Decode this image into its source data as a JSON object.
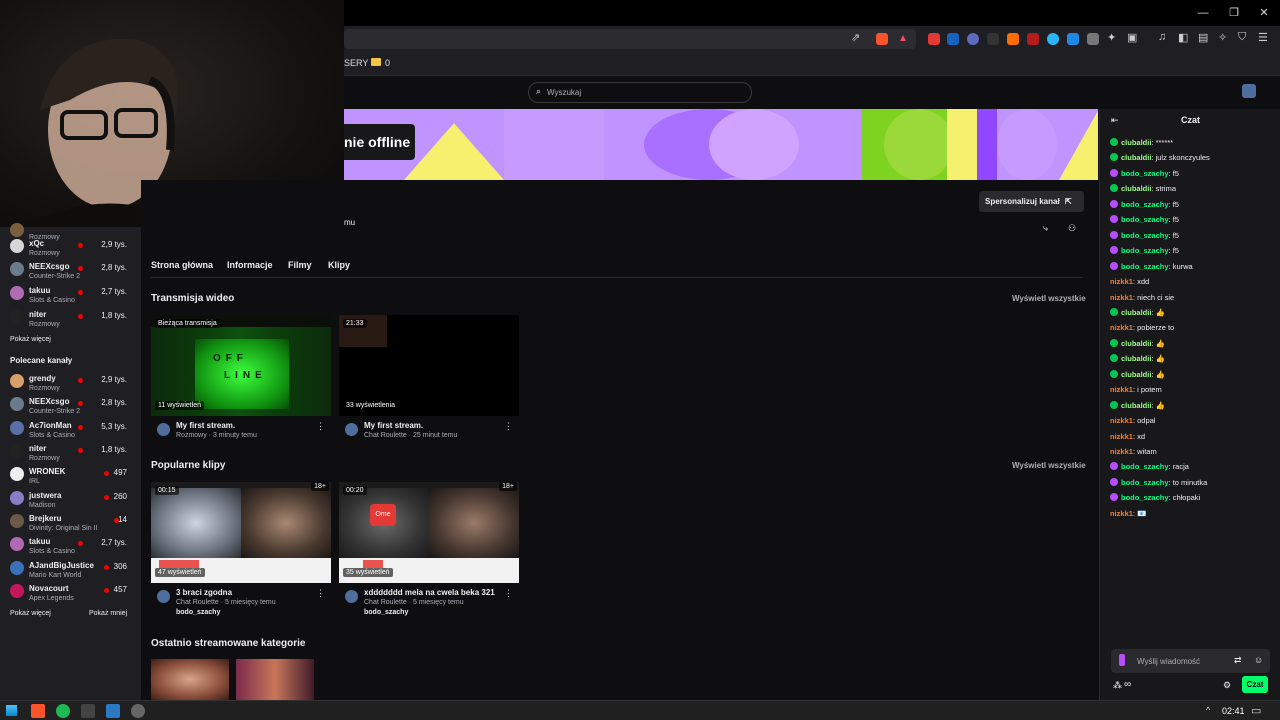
{
  "browser": {
    "bookmark_folder_label": "0",
    "bookmark_partial": "SERY",
    "window_buttons": [
      "—",
      "❐",
      "✕"
    ]
  },
  "nav": {
    "search_placeholder": "Wyszukaj"
  },
  "banner": {
    "offline_text": "nie offline",
    "customize_button": "Spersonalizuj kanał"
  },
  "channel": {
    "partial_text": "mu",
    "tabs": [
      "Strona główna",
      "Informacje",
      "Filmy",
      "Klipy"
    ]
  },
  "sidebar": {
    "followed": [
      {
        "name": "",
        "category": "Rozmowy",
        "viewers": ""
      },
      {
        "name": "xQc",
        "category": "Rozmowy",
        "viewers": "2,9 tys."
      },
      {
        "name": "NEEXcsgo",
        "category": "Counter-Strike 2",
        "viewers": "2,8 tys."
      },
      {
        "name": "takuu",
        "category": "Slots & Casino",
        "viewers": "2,7 tys."
      },
      {
        "name": "niter",
        "category": "Rozmowy",
        "viewers": "1,8 tys."
      }
    ],
    "show_more": "Pokaż więcej",
    "recommended_title": "Polecane kanały",
    "recommended": [
      {
        "name": "grendy",
        "category": "Rozmowy",
        "viewers": "2,9 tys."
      },
      {
        "name": "NEEXcsgo",
        "category": "Counter-Strike 2",
        "viewers": "2,8 tys."
      },
      {
        "name": "Ac7ionMan",
        "category": "Slots & Casino",
        "viewers": "5,3 tys."
      },
      {
        "name": "niter",
        "category": "Rozmowy",
        "viewers": "1,8 tys."
      },
      {
        "name": "WRONEK",
        "category": "IRL",
        "viewers": "497"
      },
      {
        "name": "justwera",
        "category": "Madison",
        "viewers": "260"
      },
      {
        "name": "Brejkeru",
        "category": "Divinity: Original Sin II",
        "viewers": "14"
      },
      {
        "name": "takuu",
        "category": "Slots & Casino",
        "viewers": "2,7 tys."
      },
      {
        "name": "AJandBigJustice",
        "category": "Mario Kart World",
        "viewers": "306"
      },
      {
        "name": "Novacourt",
        "category": "Apex Legends",
        "viewers": "457"
      }
    ],
    "show_more2": "Pokaż więcej",
    "show_less": "Pokaż mniej"
  },
  "videos": {
    "title": "Transmisja wideo",
    "see_all": "Wyświetl wszystkie",
    "items": [
      {
        "badge": "Bieżąca transmisja",
        "views": "11 wyświetleń",
        "title": "My first stream.",
        "sub": "Rozmowy · 3 minuty temu",
        "screen": [
          "OFF",
          "LINE"
        ]
      },
      {
        "badge": "21:33",
        "views": "33 wyświetlenia",
        "title": "My first stream.",
        "sub": "Chat Roulette · 25 minut temu"
      }
    ]
  },
  "clips": {
    "title": "Popularne klipy",
    "see_all": "Wyświetl wszystkie",
    "items": [
      {
        "badge": "00:15",
        "age": "18+",
        "views": "47 wyświetleń",
        "title": "3 braci zgodna",
        "sub": "Chat Roulette · 5 miesięcy temu",
        "author": "bodo_szachy"
      },
      {
        "badge": "00:20",
        "age": "18+",
        "views": "35 wyświetleń",
        "title": "xddddddd mela na cwela beka 321",
        "sub": "Chat Roulette · 5 miesięcy temu",
        "author": "bodo_szachy",
        "logo": "Ome"
      }
    ]
  },
  "categories": {
    "title": "Ostatnio streamowane kategorie"
  },
  "chat": {
    "title": "Czat",
    "messages": [
      {
        "user": "clubaldii",
        "text": "******",
        "mark": "#00c853",
        "color": "#9dff8a"
      },
      {
        "user": "clubaldii",
        "text": "julz skonczyules",
        "mark": "#00c853",
        "color": "#9dff8a"
      },
      {
        "user": "bodo_szachy",
        "text": "f5",
        "mark": "#b84dff",
        "color": "#00ff7f"
      },
      {
        "user": "clubaldii",
        "text": "strima",
        "mark": "#00c853",
        "color": "#9dff8a"
      },
      {
        "user": "bodo_szachy",
        "text": "f5",
        "mark": "#b84dff",
        "color": "#00ff7f"
      },
      {
        "user": "bodo_szachy",
        "text": "f5",
        "mark": "#b84dff",
        "color": "#00ff7f"
      },
      {
        "user": "bodo_szachy",
        "text": "f5",
        "mark": "#b84dff",
        "color": "#00ff7f"
      },
      {
        "user": "bodo_szachy",
        "text": "f5",
        "mark": "#b84dff",
        "color": "#00ff7f"
      },
      {
        "user": "bodo_szachy",
        "text": "kurwa",
        "mark": "#b84dff",
        "color": "#00ff7f"
      },
      {
        "user": "nizkk1",
        "text": "xdd",
        "mark": "",
        "color": "#ff7f24"
      },
      {
        "user": "nizkk1",
        "text": "niech ci sie",
        "mark": "",
        "color": "#ff7f24"
      },
      {
        "user": "clubaldii",
        "text": "👍",
        "mark": "#00c853",
        "color": "#9dff8a"
      },
      {
        "user": "nizkk1",
        "text": "pobierze to",
        "mark": "",
        "color": "#ff7f24"
      },
      {
        "user": "clubaldii",
        "text": "👍",
        "mark": "#00c853",
        "color": "#9dff8a"
      },
      {
        "user": "clubaldii",
        "text": "👍",
        "mark": "#00c853",
        "color": "#9dff8a"
      },
      {
        "user": "clubaldii",
        "text": "👍",
        "mark": "#00c853",
        "color": "#9dff8a"
      },
      {
        "user": "nizkk1",
        "text": "i potem",
        "mark": "",
        "color": "#ff7f24"
      },
      {
        "user": "clubaldii",
        "text": "👍",
        "mark": "#00c853",
        "color": "#9dff8a"
      },
      {
        "user": "nizkk1",
        "text": "odpal",
        "mark": "",
        "color": "#ff7f24"
      },
      {
        "user": "nizkk1",
        "text": "xd",
        "mark": "",
        "color": "#ff7f24"
      },
      {
        "user": "nizkk1",
        "text": "witam",
        "mark": "",
        "color": "#ff7f24"
      },
      {
        "user": "bodo_szachy",
        "text": "racja",
        "mark": "#b84dff",
        "color": "#00ff7f"
      },
      {
        "user": "bodo_szachy",
        "text": "to minutka",
        "mark": "#b84dff",
        "color": "#00ff7f"
      },
      {
        "user": "bodo_szachy",
        "text": "chłopaki",
        "mark": "#b84dff",
        "color": "#00ff7f"
      },
      {
        "user": "nizkk1",
        "text": "📧",
        "mark": "",
        "color": "#ff7f24"
      }
    ],
    "input_placeholder": "Wyślij wiadomość",
    "send_button": "Czat",
    "points": "∞"
  },
  "taskbar": {
    "time": "02:41"
  },
  "colors": {
    "accent": "#bf94ff",
    "live": "#eb0400",
    "chat_button": "#00ff6a"
  }
}
